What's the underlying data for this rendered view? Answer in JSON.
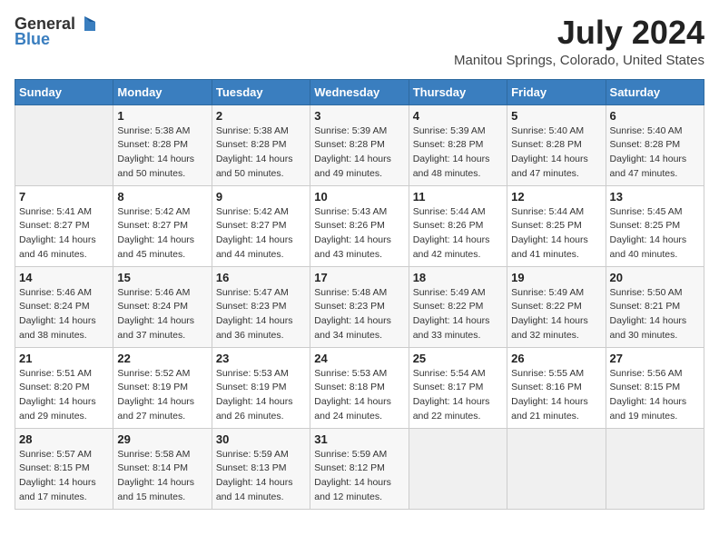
{
  "header": {
    "logo_general": "General",
    "logo_blue": "Blue",
    "month": "July 2024",
    "location": "Manitou Springs, Colorado, United States"
  },
  "days_of_week": [
    "Sunday",
    "Monday",
    "Tuesday",
    "Wednesday",
    "Thursday",
    "Friday",
    "Saturday"
  ],
  "weeks": [
    [
      {
        "day": "",
        "info": ""
      },
      {
        "day": "1",
        "info": "Sunrise: 5:38 AM\nSunset: 8:28 PM\nDaylight: 14 hours and 50 minutes."
      },
      {
        "day": "2",
        "info": "Sunrise: 5:38 AM\nSunset: 8:28 PM\nDaylight: 14 hours and 50 minutes."
      },
      {
        "day": "3",
        "info": "Sunrise: 5:39 AM\nSunset: 8:28 PM\nDaylight: 14 hours and 49 minutes."
      },
      {
        "day": "4",
        "info": "Sunrise: 5:39 AM\nSunset: 8:28 PM\nDaylight: 14 hours and 48 minutes."
      },
      {
        "day": "5",
        "info": "Sunrise: 5:40 AM\nSunset: 8:28 PM\nDaylight: 14 hours and 47 minutes."
      },
      {
        "day": "6",
        "info": "Sunrise: 5:40 AM\nSunset: 8:28 PM\nDaylight: 14 hours and 47 minutes."
      }
    ],
    [
      {
        "day": "7",
        "info": "Sunrise: 5:41 AM\nSunset: 8:27 PM\nDaylight: 14 hours and 46 minutes."
      },
      {
        "day": "8",
        "info": "Sunrise: 5:42 AM\nSunset: 8:27 PM\nDaylight: 14 hours and 45 minutes."
      },
      {
        "day": "9",
        "info": "Sunrise: 5:42 AM\nSunset: 8:27 PM\nDaylight: 14 hours and 44 minutes."
      },
      {
        "day": "10",
        "info": "Sunrise: 5:43 AM\nSunset: 8:26 PM\nDaylight: 14 hours and 43 minutes."
      },
      {
        "day": "11",
        "info": "Sunrise: 5:44 AM\nSunset: 8:26 PM\nDaylight: 14 hours and 42 minutes."
      },
      {
        "day": "12",
        "info": "Sunrise: 5:44 AM\nSunset: 8:25 PM\nDaylight: 14 hours and 41 minutes."
      },
      {
        "day": "13",
        "info": "Sunrise: 5:45 AM\nSunset: 8:25 PM\nDaylight: 14 hours and 40 minutes."
      }
    ],
    [
      {
        "day": "14",
        "info": "Sunrise: 5:46 AM\nSunset: 8:24 PM\nDaylight: 14 hours and 38 minutes."
      },
      {
        "day": "15",
        "info": "Sunrise: 5:46 AM\nSunset: 8:24 PM\nDaylight: 14 hours and 37 minutes."
      },
      {
        "day": "16",
        "info": "Sunrise: 5:47 AM\nSunset: 8:23 PM\nDaylight: 14 hours and 36 minutes."
      },
      {
        "day": "17",
        "info": "Sunrise: 5:48 AM\nSunset: 8:23 PM\nDaylight: 14 hours and 34 minutes."
      },
      {
        "day": "18",
        "info": "Sunrise: 5:49 AM\nSunset: 8:22 PM\nDaylight: 14 hours and 33 minutes."
      },
      {
        "day": "19",
        "info": "Sunrise: 5:49 AM\nSunset: 8:22 PM\nDaylight: 14 hours and 32 minutes."
      },
      {
        "day": "20",
        "info": "Sunrise: 5:50 AM\nSunset: 8:21 PM\nDaylight: 14 hours and 30 minutes."
      }
    ],
    [
      {
        "day": "21",
        "info": "Sunrise: 5:51 AM\nSunset: 8:20 PM\nDaylight: 14 hours and 29 minutes."
      },
      {
        "day": "22",
        "info": "Sunrise: 5:52 AM\nSunset: 8:19 PM\nDaylight: 14 hours and 27 minutes."
      },
      {
        "day": "23",
        "info": "Sunrise: 5:53 AM\nSunset: 8:19 PM\nDaylight: 14 hours and 26 minutes."
      },
      {
        "day": "24",
        "info": "Sunrise: 5:53 AM\nSunset: 8:18 PM\nDaylight: 14 hours and 24 minutes."
      },
      {
        "day": "25",
        "info": "Sunrise: 5:54 AM\nSunset: 8:17 PM\nDaylight: 14 hours and 22 minutes."
      },
      {
        "day": "26",
        "info": "Sunrise: 5:55 AM\nSunset: 8:16 PM\nDaylight: 14 hours and 21 minutes."
      },
      {
        "day": "27",
        "info": "Sunrise: 5:56 AM\nSunset: 8:15 PM\nDaylight: 14 hours and 19 minutes."
      }
    ],
    [
      {
        "day": "28",
        "info": "Sunrise: 5:57 AM\nSunset: 8:15 PM\nDaylight: 14 hours and 17 minutes."
      },
      {
        "day": "29",
        "info": "Sunrise: 5:58 AM\nSunset: 8:14 PM\nDaylight: 14 hours and 15 minutes."
      },
      {
        "day": "30",
        "info": "Sunrise: 5:59 AM\nSunset: 8:13 PM\nDaylight: 14 hours and 14 minutes."
      },
      {
        "day": "31",
        "info": "Sunrise: 5:59 AM\nSunset: 8:12 PM\nDaylight: 14 hours and 12 minutes."
      },
      {
        "day": "",
        "info": ""
      },
      {
        "day": "",
        "info": ""
      },
      {
        "day": "",
        "info": ""
      }
    ]
  ]
}
